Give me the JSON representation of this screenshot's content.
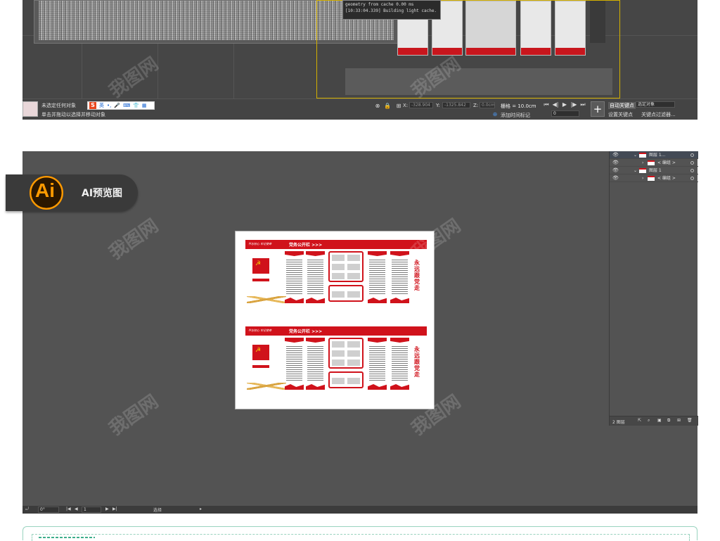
{
  "max": {
    "log_lines": [
      "geometry from cache 0.00 ms",
      "[10:33:04.339] Building light cache."
    ],
    "status": {
      "line1": "未选定任何对象",
      "line2": "单击并拖动以选择并移动对象",
      "ime_label": "英",
      "x_label": "X:",
      "x_value": "-328.904",
      "y_label": "Y:",
      "y_value": "-1325.842",
      "z_label": "Z:",
      "z_value": "0.0cm",
      "grid_label": "栅格 = 10.0cm",
      "time_tag": "添加时间标记",
      "frame_value": "0",
      "auto_key": "自动关键点",
      "select_object": "选定对象",
      "set_key": "设置关键点",
      "key_filter": "关键点过滤器..."
    }
  },
  "ai": {
    "badge_logo": "Ai",
    "badge_label": "AI预览图",
    "wall": {
      "slogan": "不忘初心 牢记使命",
      "title": "党务公开栏 >>>",
      "vertical_title": "永远跟党走"
    },
    "layers": {
      "rows": [
        {
          "name": "图层 1...",
          "selected": true
        },
        {
          "name": "< 编组 >",
          "selected": false
        },
        {
          "name": "图层 1",
          "selected": false
        },
        {
          "name": "< 编组 >",
          "selected": false
        }
      ],
      "footer_label": "2 图层"
    },
    "bottom": {
      "zoom": "0°",
      "page": "1",
      "tool": "选择"
    }
  },
  "watermark": "我图网",
  "colors": {
    "party_red": "#d0121b",
    "ai_orange": "#ff9a00",
    "canvas_gray": "#535353"
  }
}
